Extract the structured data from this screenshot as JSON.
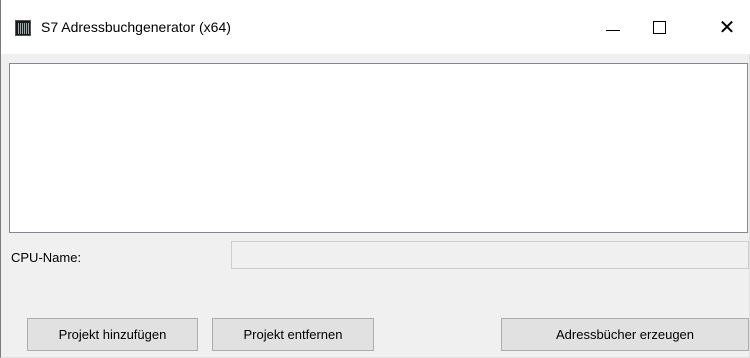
{
  "window": {
    "title": "S7 Adressbuchgenerator (x64)",
    "app_icon": "app-icon",
    "controls": {
      "minimize": "minimize-icon",
      "maximize": "maximize-icon",
      "close": "close-icon",
      "close_glyph": "✕"
    }
  },
  "project_list": {
    "items": []
  },
  "cpu": {
    "label": "CPU-Name:",
    "value": ""
  },
  "buttons": {
    "add_project": "Projekt hinzufügen",
    "remove_project": "Projekt entfernen",
    "generate": "Adressbücher erzeugen"
  }
}
